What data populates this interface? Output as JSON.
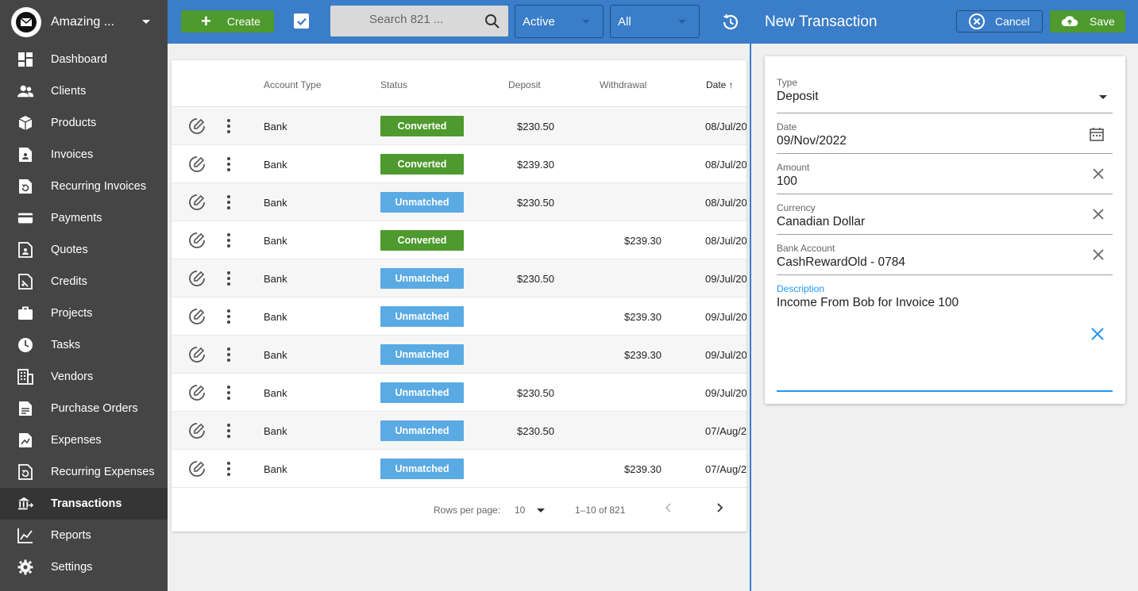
{
  "sidebar": {
    "company_name": "Amazing ...",
    "items": [
      {
        "label": "Dashboard",
        "icon": "dashboard-icon"
      },
      {
        "label": "Clients",
        "icon": "clients-icon"
      },
      {
        "label": "Products",
        "icon": "products-icon"
      },
      {
        "label": "Invoices",
        "icon": "invoices-icon"
      },
      {
        "label": "Recurring Invoices",
        "icon": "recurring-invoices-icon"
      },
      {
        "label": "Payments",
        "icon": "payments-icon"
      },
      {
        "label": "Quotes",
        "icon": "quotes-icon"
      },
      {
        "label": "Credits",
        "icon": "credits-icon"
      },
      {
        "label": "Projects",
        "icon": "projects-icon"
      },
      {
        "label": "Tasks",
        "icon": "tasks-icon"
      },
      {
        "label": "Vendors",
        "icon": "vendors-icon"
      },
      {
        "label": "Purchase Orders",
        "icon": "purchase-orders-icon"
      },
      {
        "label": "Expenses",
        "icon": "expenses-icon"
      },
      {
        "label": "Recurring Expenses",
        "icon": "recurring-expenses-icon"
      },
      {
        "label": "Transactions",
        "icon": "transactions-icon",
        "active": true
      },
      {
        "label": "Reports",
        "icon": "reports-icon"
      },
      {
        "label": "Settings",
        "icon": "settings-icon"
      }
    ]
  },
  "toolbar": {
    "create_label": "Create",
    "search_placeholder": "Search 821 ...",
    "status_filter": "Active",
    "type_filter": "All"
  },
  "table": {
    "headers": {
      "account_type": "Account Type",
      "status": "Status",
      "deposit": "Deposit",
      "withdrawal": "Withdrawal",
      "date": "Date"
    },
    "rows": [
      {
        "account_type": "Bank",
        "status": "Converted",
        "deposit": "$230.50",
        "withdrawal": "",
        "date": "08/Jul/20"
      },
      {
        "account_type": "Bank",
        "status": "Converted",
        "deposit": "$239.30",
        "withdrawal": "",
        "date": "08/Jul/20"
      },
      {
        "account_type": "Bank",
        "status": "Unmatched",
        "deposit": "$230.50",
        "withdrawal": "",
        "date": "08/Jul/20"
      },
      {
        "account_type": "Bank",
        "status": "Converted",
        "deposit": "",
        "withdrawal": "$239.30",
        "date": "08/Jul/20"
      },
      {
        "account_type": "Bank",
        "status": "Unmatched",
        "deposit": "$230.50",
        "withdrawal": "",
        "date": "09/Jul/20"
      },
      {
        "account_type": "Bank",
        "status": "Unmatched",
        "deposit": "",
        "withdrawal": "$239.30",
        "date": "09/Jul/20"
      },
      {
        "account_type": "Bank",
        "status": "Unmatched",
        "deposit": "",
        "withdrawal": "$239.30",
        "date": "09/Jul/20"
      },
      {
        "account_type": "Bank",
        "status": "Unmatched",
        "deposit": "$230.50",
        "withdrawal": "",
        "date": "09/Jul/20"
      },
      {
        "account_type": "Bank",
        "status": "Unmatched",
        "deposit": "$230.50",
        "withdrawal": "",
        "date": "07/Aug/2"
      },
      {
        "account_type": "Bank",
        "status": "Unmatched",
        "deposit": "",
        "withdrawal": "$239.30",
        "date": "07/Aug/2"
      }
    ],
    "pagination": {
      "rows_per_page_label": "Rows per page:",
      "rows_per_page": "10",
      "range": "1–10 of 821"
    }
  },
  "panel": {
    "title": "New Transaction",
    "cancel_label": "Cancel",
    "save_label": "Save",
    "fields": {
      "type": {
        "label": "Type",
        "value": "Deposit"
      },
      "date": {
        "label": "Date",
        "value": "09/Nov/2022"
      },
      "amount": {
        "label": "Amount",
        "value": "100"
      },
      "currency": {
        "label": "Currency",
        "value": "Canadian Dollar"
      },
      "bank_account": {
        "label": "Bank Account",
        "value": "CashRewardOld - 0784"
      },
      "description": {
        "label": "Description",
        "value": "Income From Bob for Invoice 100"
      }
    }
  },
  "colors": {
    "primary": "#3a7dc9",
    "success": "#4e9a2e",
    "unmatched": "#5aaae3",
    "sidebar": "#454545"
  }
}
